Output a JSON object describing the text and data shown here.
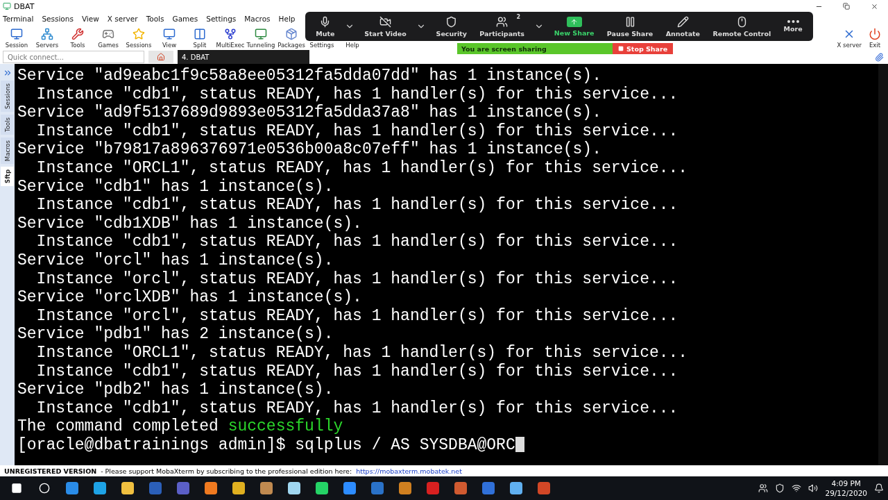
{
  "window": {
    "title": "DBAT"
  },
  "menu": [
    "Terminal",
    "Sessions",
    "View",
    "X server",
    "Tools",
    "Games",
    "Settings",
    "Macros",
    "Help"
  ],
  "toolbar": [
    {
      "label": "Session"
    },
    {
      "label": "Servers"
    },
    {
      "label": "Tools"
    },
    {
      "label": "Games"
    },
    {
      "label": "Sessions"
    },
    {
      "label": "View"
    },
    {
      "label": "Split"
    },
    {
      "label": "MultiExec"
    },
    {
      "label": "Tunneling"
    },
    {
      "label": "Packages"
    },
    {
      "label": "Settings"
    },
    {
      "label": "Help"
    }
  ],
  "toolbar_right": [
    {
      "label": "X server"
    },
    {
      "label": "Exit"
    }
  ],
  "quick_connect": {
    "placeholder": "Quick connect..."
  },
  "tabs": [
    {
      "label": "4. DBAT",
      "selected": true
    }
  ],
  "side_tabs": [
    {
      "label": "Sessions",
      "selected": false
    },
    {
      "label": "Tools",
      "selected": false
    },
    {
      "label": "Macros",
      "selected": false
    },
    {
      "label": "Sftp",
      "selected": true
    }
  ],
  "terminal": {
    "lines": [
      {
        "kind": "text",
        "text": "Service \"ad9eabc1f9c58a8ee05312fa5dda07dd\" has 1 instance(s)."
      },
      {
        "kind": "text",
        "text": "  Instance \"cdb1\", status READY, has 1 handler(s) for this service..."
      },
      {
        "kind": "text",
        "text": "Service \"ad9f5137689d9893e05312fa5dda37a8\" has 1 instance(s)."
      },
      {
        "kind": "text",
        "text": "  Instance \"cdb1\", status READY, has 1 handler(s) for this service..."
      },
      {
        "kind": "text",
        "text": "Service \"b79817a896376971e0536b00a8c07eff\" has 1 instance(s)."
      },
      {
        "kind": "text",
        "text": "  Instance \"ORCL1\", status READY, has 1 handler(s) for this service..."
      },
      {
        "kind": "text",
        "text": "Service \"cdb1\" has 1 instance(s)."
      },
      {
        "kind": "text",
        "text": "  Instance \"cdb1\", status READY, has 1 handler(s) for this service..."
      },
      {
        "kind": "text",
        "text": "Service \"cdb1XDB\" has 1 instance(s)."
      },
      {
        "kind": "text",
        "text": "  Instance \"cdb1\", status READY, has 1 handler(s) for this service..."
      },
      {
        "kind": "text",
        "text": "Service \"orcl\" has 1 instance(s)."
      },
      {
        "kind": "text",
        "text": "  Instance \"orcl\", status READY, has 1 handler(s) for this service..."
      },
      {
        "kind": "text",
        "text": "Service \"orclXDB\" has 1 instance(s)."
      },
      {
        "kind": "text",
        "text": "  Instance \"orcl\", status READY, has 1 handler(s) for this service..."
      },
      {
        "kind": "text",
        "text": "Service \"pdb1\" has 2 instance(s)."
      },
      {
        "kind": "text",
        "text": "  Instance \"ORCL1\", status READY, has 1 handler(s) for this service..."
      },
      {
        "kind": "text",
        "text": "  Instance \"cdb1\", status READY, has 1 handler(s) for this service..."
      },
      {
        "kind": "text",
        "text": "Service \"pdb2\" has 1 instance(s)."
      },
      {
        "kind": "text",
        "text": "  Instance \"cdb1\", status READY, has 1 handler(s) for this service..."
      },
      {
        "kind": "status",
        "text": "The command completed ",
        "status": "successfully"
      },
      {
        "kind": "prompt",
        "prompt": "[oracle@dbatrainings admin]$ ",
        "command": "sqlplus / AS SYSDBA@ORC"
      }
    ]
  },
  "status_bar": {
    "label": "UNREGISTERED VERSION",
    "message": "-  Please support MobaXterm by subscribing to the professional edition here:",
    "link": "https://mobaxterm.mobatek.net"
  },
  "meeting_toolbar": {
    "buttons": [
      {
        "label": "Mute",
        "menu": true
      },
      {
        "label": "Start Video",
        "menu": true
      },
      {
        "label": "Security",
        "menu": false
      },
      {
        "label": "Participants",
        "count": "2",
        "menu": true
      },
      {
        "label": "New Share",
        "menu": false
      },
      {
        "label": "Pause Share",
        "menu": false
      },
      {
        "label": "Annotate",
        "menu": false
      },
      {
        "label": "Remote Control",
        "menu": false
      },
      {
        "label": "More",
        "menu": false
      }
    ],
    "sharing_banner": "You are screen sharing",
    "stop_button": "Stop Share"
  },
  "taskbar": {
    "time": "4:09 PM",
    "date": "29/12/2020"
  }
}
